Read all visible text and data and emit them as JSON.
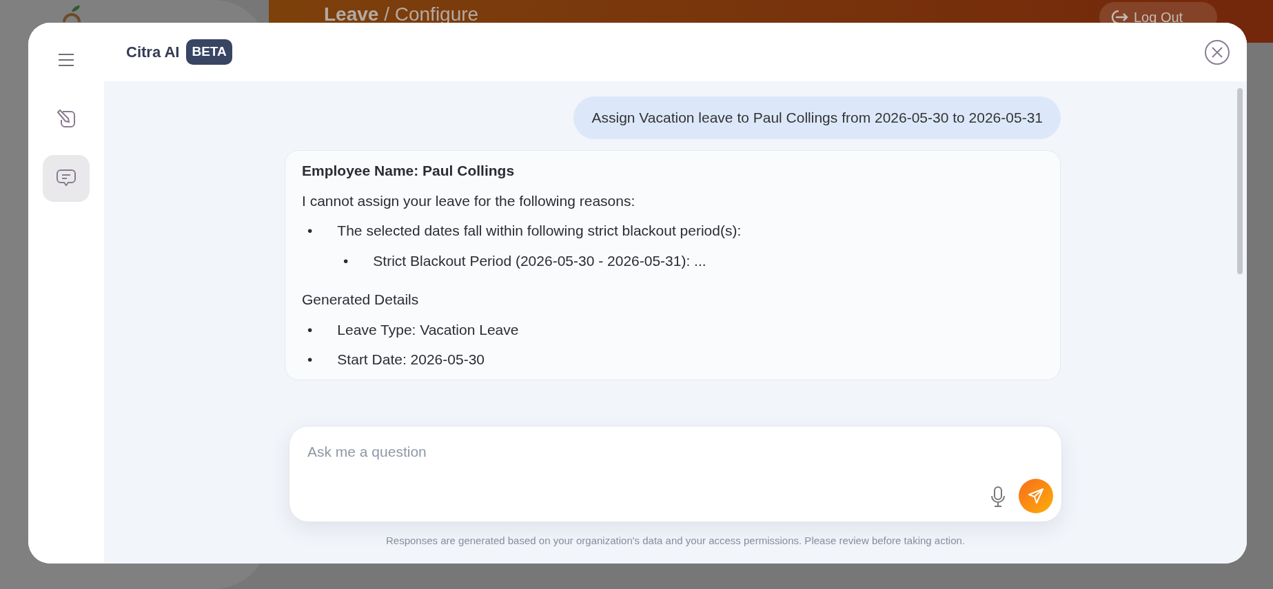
{
  "background": {
    "breadcrumb": {
      "module": "Leave",
      "separator": " / ",
      "page": "Configure"
    },
    "logout": {
      "label": "Log Out"
    }
  },
  "assistant": {
    "title": "Citra AI",
    "badge": "BETA",
    "rail": [
      {
        "kind": "menu",
        "selected": false
      },
      {
        "kind": "new-chat",
        "selected": false
      },
      {
        "kind": "chats",
        "selected": true
      }
    ],
    "messages": [
      {
        "kind": "user",
        "text": "Assign Vacation leave to Paul Collings from 2026-05-30 to 2026-05-31"
      },
      {
        "kind": "reply",
        "blocks": [
          {
            "kind": "heading",
            "text": "Employee Name: Paul Collings"
          },
          {
            "kind": "paragraph",
            "text": "I cannot assign your leave for the following reasons:"
          },
          {
            "kind": "list",
            "items": [
              {
                "marker": "•",
                "text": "The selected dates fall within following strict blackout period(s):",
                "children": [
                  {
                    "marker": "•",
                    "text": "Strict Blackout Period (2026-05-30 - 2026-05-31): ..."
                  }
                ]
              }
            ]
          },
          {
            "kind": "paragraph",
            "text": "Generated Details"
          },
          {
            "kind": "list",
            "items": [
              {
                "marker": "•",
                "text": "Leave Type: Vacation Leave"
              },
              {
                "marker": "•",
                "text": "Start Date: 2026-05-30"
              }
            ]
          }
        ]
      }
    ],
    "composer": {
      "placeholder": "Ask me a question"
    },
    "disclaimer": "Responses are generated based on your organization's data and your access permissions. Please review before taking action."
  }
}
